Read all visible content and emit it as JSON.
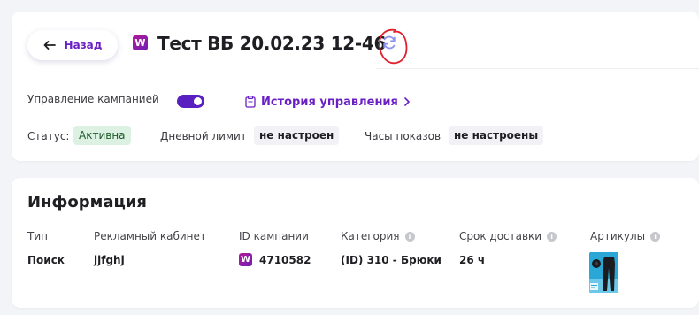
{
  "header": {
    "back_label": "Назад",
    "badge_letter": "W",
    "title": "Тест ВБ 20.02.23 12-46"
  },
  "controls": {
    "management_label": "Управление кампанией",
    "management_enabled": true,
    "history_label": "История управления"
  },
  "status_row": {
    "status_label": "Статус:",
    "status_value": "Активна",
    "daily_limit_label": "Дневной лимит",
    "daily_limit_value": "не настроен",
    "hours_label": "Часы показов",
    "hours_value": "не настроены"
  },
  "info": {
    "title": "Информация",
    "columns": {
      "type": "Тип",
      "cabinet": "Рекламный кабинет",
      "campaign_id": "ID кампании",
      "category": "Категория",
      "delivery": "Срок доставки",
      "articles": "Артикулы"
    },
    "info_glyph": "i",
    "row": {
      "type": "Поиск",
      "cabinet": "jjfghj",
      "campaign_id": "4710582",
      "category": "(ID) 310 - Брюки",
      "delivery": "26 ч"
    }
  },
  "colors": {
    "accent": "#6a1fc5",
    "toggle_on": "#5a1fc0",
    "status_active_bg": "#dcf1e2",
    "annotation": "#e0202a"
  },
  "icons": [
    "arrow-left-icon",
    "wb-logo-icon",
    "refresh-icon",
    "clipboard-icon",
    "chevron-right-icon",
    "info-icon"
  ]
}
